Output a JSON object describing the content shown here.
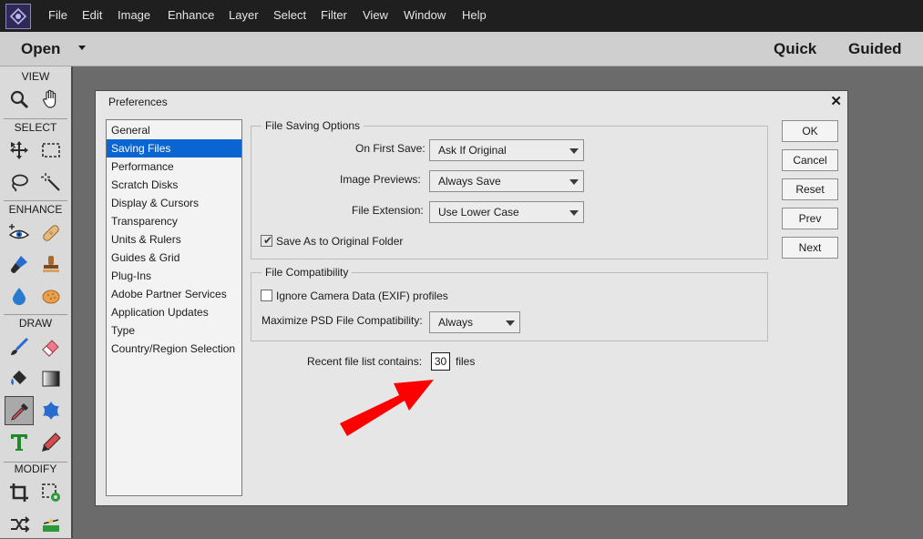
{
  "menubar": {
    "items": [
      "File",
      "Edit",
      "Image",
      "Enhance",
      "Layer",
      "Select",
      "Filter",
      "View",
      "Window",
      "Help"
    ]
  },
  "optionsbar": {
    "open_label": "Open",
    "modes": [
      "Quick",
      "Guided"
    ]
  },
  "toolbox": {
    "sections": [
      "VIEW",
      "SELECT",
      "ENHANCE",
      "DRAW",
      "MODIFY"
    ],
    "tools": [
      "zoom-icon",
      "hand-icon",
      "move-icon",
      "marquee-icon",
      "lasso-icon",
      "quick-selection-icon",
      "red-eye-icon",
      "spot-healing-icon",
      "smart-brush-icon",
      "clone-stamp-icon",
      "blur-icon",
      "sponge-icon",
      "brush-icon",
      "eraser-icon",
      "paint-bucket-icon",
      "gradient-icon",
      "eyedropper-icon",
      "custom-shape-icon",
      "type-icon",
      "pencil-icon",
      "crop-icon",
      "recompose-icon",
      "content-aware-move-icon",
      "straighten-icon"
    ]
  },
  "dialog": {
    "title": "Preferences",
    "close": "✕",
    "categories": [
      "General",
      "Saving Files",
      "Performance",
      "Scratch Disks",
      "Display & Cursors",
      "Transparency",
      "Units & Rulers",
      "Guides & Grid",
      "Plug-Ins",
      "Adobe Partner Services",
      "Application Updates",
      "Type",
      "Country/Region Selection"
    ],
    "selected_category": "Saving Files",
    "file_saving": {
      "title": "File Saving Options",
      "on_first_save_label": "On First Save:",
      "on_first_save_value": "Ask If Original",
      "image_previews_label": "Image Previews:",
      "image_previews_value": "Always Save",
      "file_extension_label": "File Extension:",
      "file_extension_value": "Use Lower Case",
      "save_as_original_label": "Save As to Original Folder",
      "save_as_original_checked": true
    },
    "compatibility": {
      "title": "File Compatibility",
      "ignore_exif_label": "Ignore Camera Data (EXIF) profiles",
      "ignore_exif_checked": false,
      "maximize_psd_label": "Maximize PSD File Compatibility:",
      "maximize_psd_value": "Always"
    },
    "recent": {
      "label": "Recent file list contains:",
      "value": "30",
      "suffix": "files"
    },
    "buttons": {
      "ok": "OK",
      "cancel": "Cancel",
      "reset": "Reset",
      "prev": "Prev",
      "next": "Next"
    }
  },
  "colors": {
    "selection": "#0a64d2",
    "annotation_arrow": "#ff0000"
  }
}
